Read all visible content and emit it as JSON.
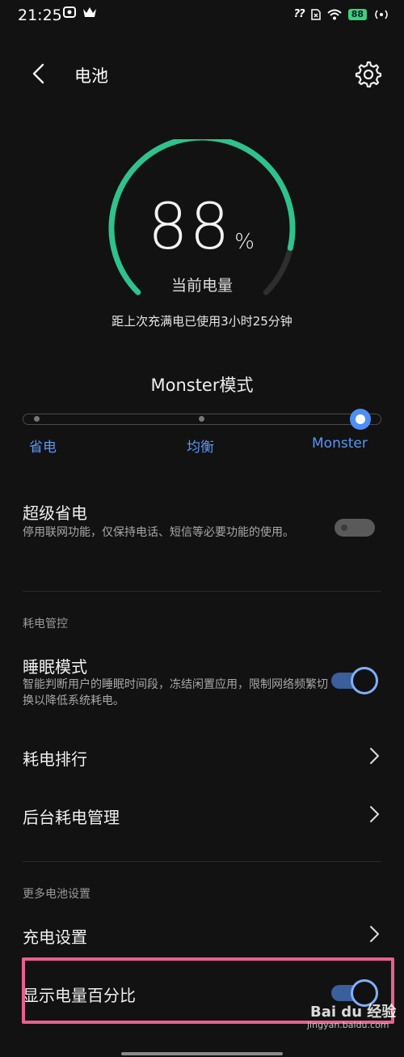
{
  "status_bar": {
    "time": "21:25",
    "signal_text": "??",
    "battery": "88"
  },
  "header": {
    "title": "电池"
  },
  "gauge": {
    "value": "88",
    "unit": "%",
    "fraction": 0.88,
    "label": "当前电量",
    "usage": "距上次充满电已使用3小时25分钟",
    "accent": "#2fc28c"
  },
  "mode": {
    "title": "Monster模式",
    "options": [
      "省电",
      "均衡",
      "Monster"
    ],
    "selected_index": 2,
    "accent": "#4f8ef7"
  },
  "super_save": {
    "title": "超级省电",
    "desc": "停用联网功能，仅保持电话、短信等必要功能的使用。",
    "enabled": false
  },
  "power_control": {
    "section_title": "耗电管控",
    "sleep_mode": {
      "title": "睡眠模式",
      "desc": "智能判断用户的睡眠时间段，冻结闲置应用，限制网络频繁切换以降低系统耗电。",
      "enabled": true
    },
    "ranking": "耗电排行",
    "background": "后台耗电管理"
  },
  "more_settings": {
    "section_title": "更多电池设置",
    "charging": "充电设置",
    "show_percentage": {
      "title": "显示电量百分比",
      "enabled": true
    }
  },
  "watermark": {
    "brand": "Bai du 经验",
    "url": "jingyan.baidu.com"
  },
  "colors": {
    "highlight": "#e8608f",
    "toggle_on": "#7eb0ff"
  }
}
